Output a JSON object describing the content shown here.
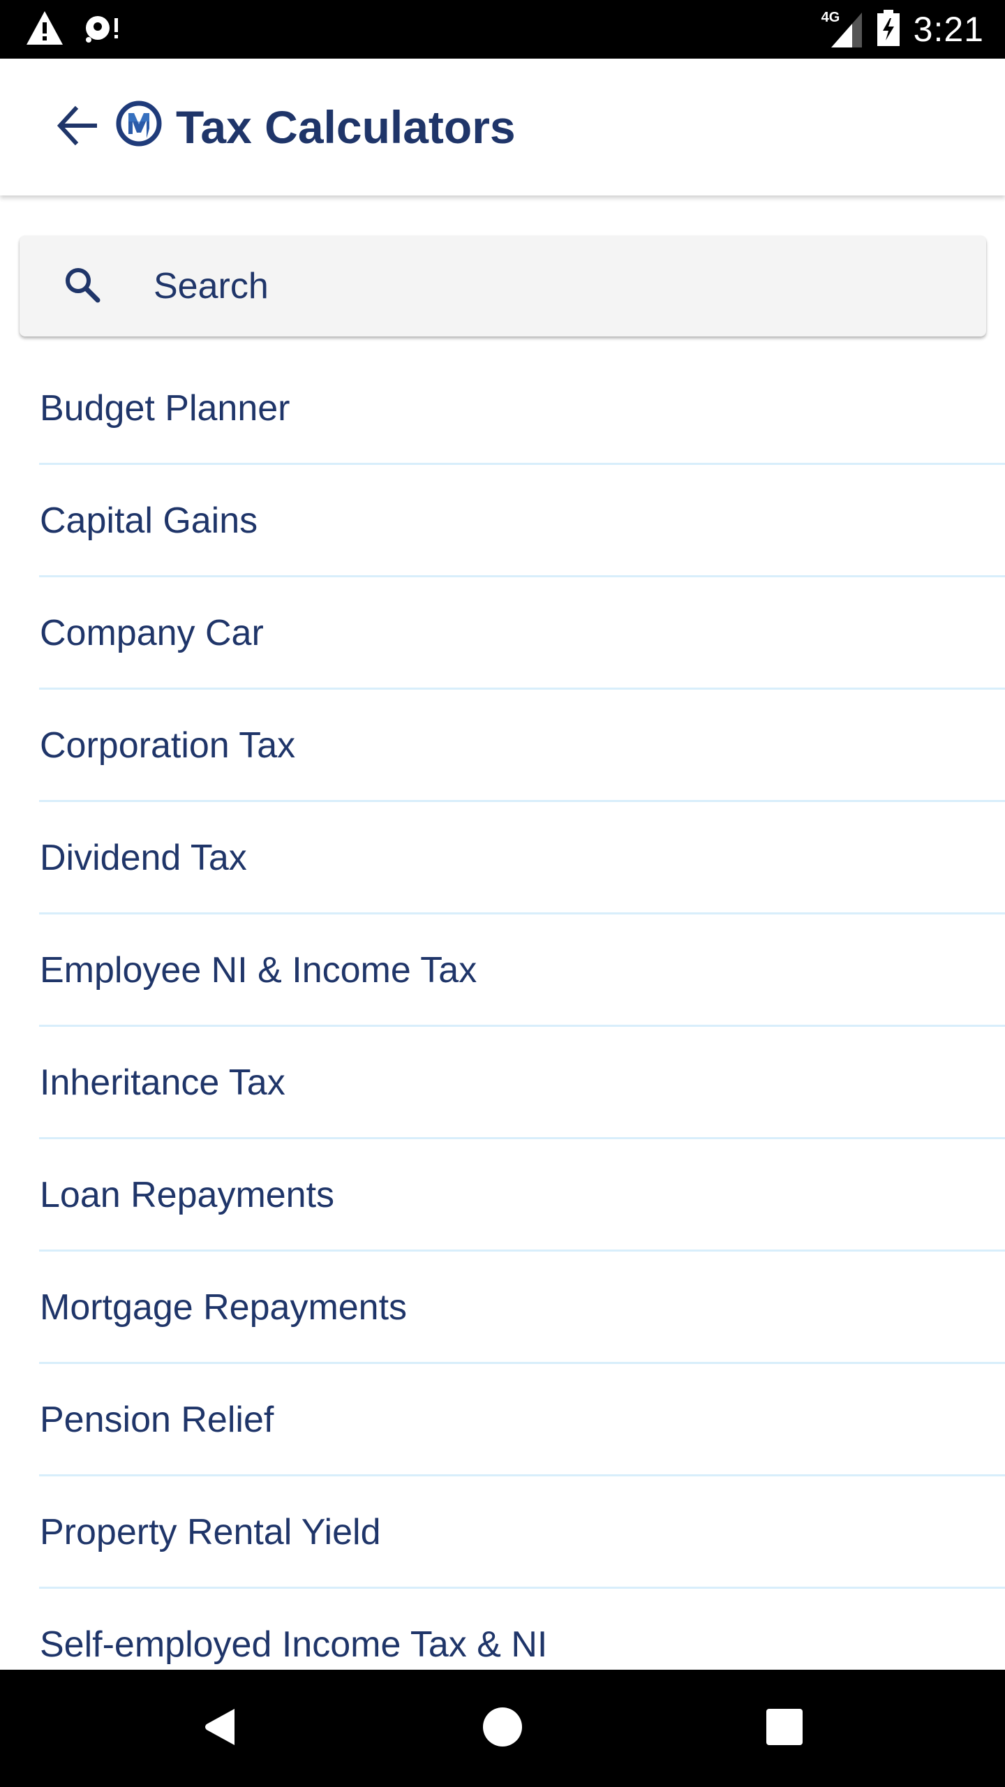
{
  "status_bar": {
    "left_icons": [
      "warning-icon",
      "sync-alert-icon"
    ],
    "network_label": "4G",
    "icons": [
      "signal-icon",
      "battery-charging-icon"
    ],
    "time": "3:21"
  },
  "app_bar": {
    "back_icon": "arrow-left-icon",
    "logo": "m-logo",
    "title": "Tax Calculators"
  },
  "search": {
    "icon": "search-icon",
    "placeholder": "Search",
    "value": ""
  },
  "calculators": [
    {
      "label": "Budget Planner"
    },
    {
      "label": "Capital Gains"
    },
    {
      "label": "Company Car"
    },
    {
      "label": "Corporation Tax"
    },
    {
      "label": "Dividend Tax"
    },
    {
      "label": "Employee NI & Income Tax"
    },
    {
      "label": "Inheritance Tax"
    },
    {
      "label": "Loan Repayments"
    },
    {
      "label": "Mortgage Repayments"
    },
    {
      "label": "Pension Relief"
    },
    {
      "label": "Property Rental Yield"
    },
    {
      "label": "Self-employed Income Tax & NI"
    }
  ],
  "nav_bar": {
    "buttons": [
      "back-triangle-icon",
      "home-circle-icon",
      "recents-square-icon"
    ]
  },
  "colors": {
    "primary_text": "#1f3569",
    "divider": "#d8eefb",
    "search_bg": "#f4f4f4"
  }
}
